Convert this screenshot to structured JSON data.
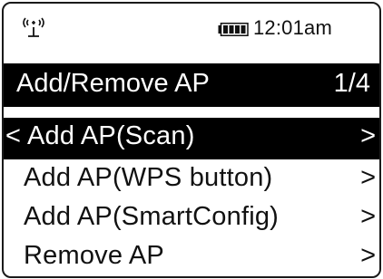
{
  "status_bar": {
    "signal_icon": "wifi-antenna-icon",
    "battery_icon": "battery-full-icon",
    "time": "12:01am"
  },
  "header": {
    "title": "Add/Remove AP",
    "page": "1/4"
  },
  "menu": {
    "back_symbol": "<",
    "arrow_symbol": ">",
    "items": [
      {
        "label": "Add AP(Scan)",
        "selected": true
      },
      {
        "label": "Add AP(WPS button)",
        "selected": false
      },
      {
        "label": "Add AP(SmartConfig)",
        "selected": false
      },
      {
        "label": "Remove AP",
        "selected": false
      }
    ]
  },
  "colors": {
    "highlight_bg": "#000000",
    "highlight_fg": "#ffffff",
    "text": "#111111"
  }
}
